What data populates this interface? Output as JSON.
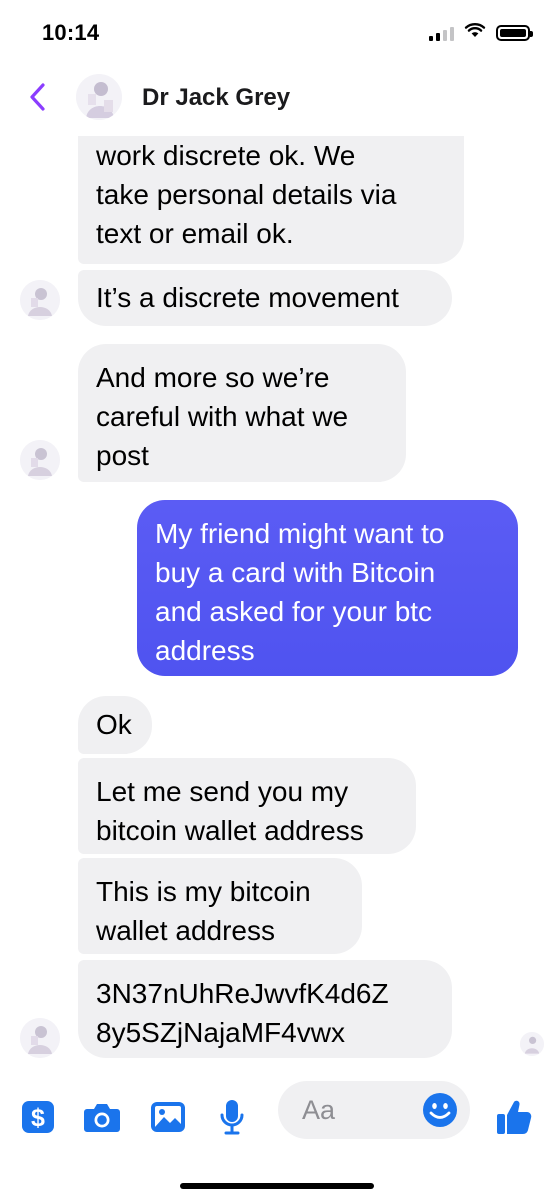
{
  "status_bar": {
    "time": "10:14"
  },
  "header": {
    "contact_name": "Dr Jack Grey"
  },
  "messages": [
    {
      "direction": "in",
      "text": "work discrete ok. We\ntake personal details via\ntext or email ok."
    },
    {
      "direction": "in",
      "text": "It’s a discrete movement"
    },
    {
      "direction": "in",
      "text": "And more so we’re\ncareful with what we\npost"
    },
    {
      "direction": "out",
      "text": "My friend might want  to\nbuy a card with Bitcoin\nand asked for your btc\naddress"
    },
    {
      "direction": "in",
      "text": "Ok"
    },
    {
      "direction": "in",
      "text": "Let me send you my\nbitcoin wallet address"
    },
    {
      "direction": "in",
      "text": "This is my bitcoin\nwallet address"
    },
    {
      "direction": "in",
      "text": "3N37nUhReJwvfK4d6Z\n8y5SZjNajaMF4vwx"
    }
  ],
  "composer": {
    "placeholder": "Aa",
    "icons": [
      "dollar-icon",
      "camera-icon",
      "photo-icon",
      "microphone-icon",
      "emoji-icon",
      "thumbs-up-icon"
    ]
  },
  "colors": {
    "accent": "#1a74ec",
    "outgoing_bubble": "#5355f2",
    "incoming_bubble": "#f0f0f2",
    "back_chevron": "#8b3dff"
  }
}
